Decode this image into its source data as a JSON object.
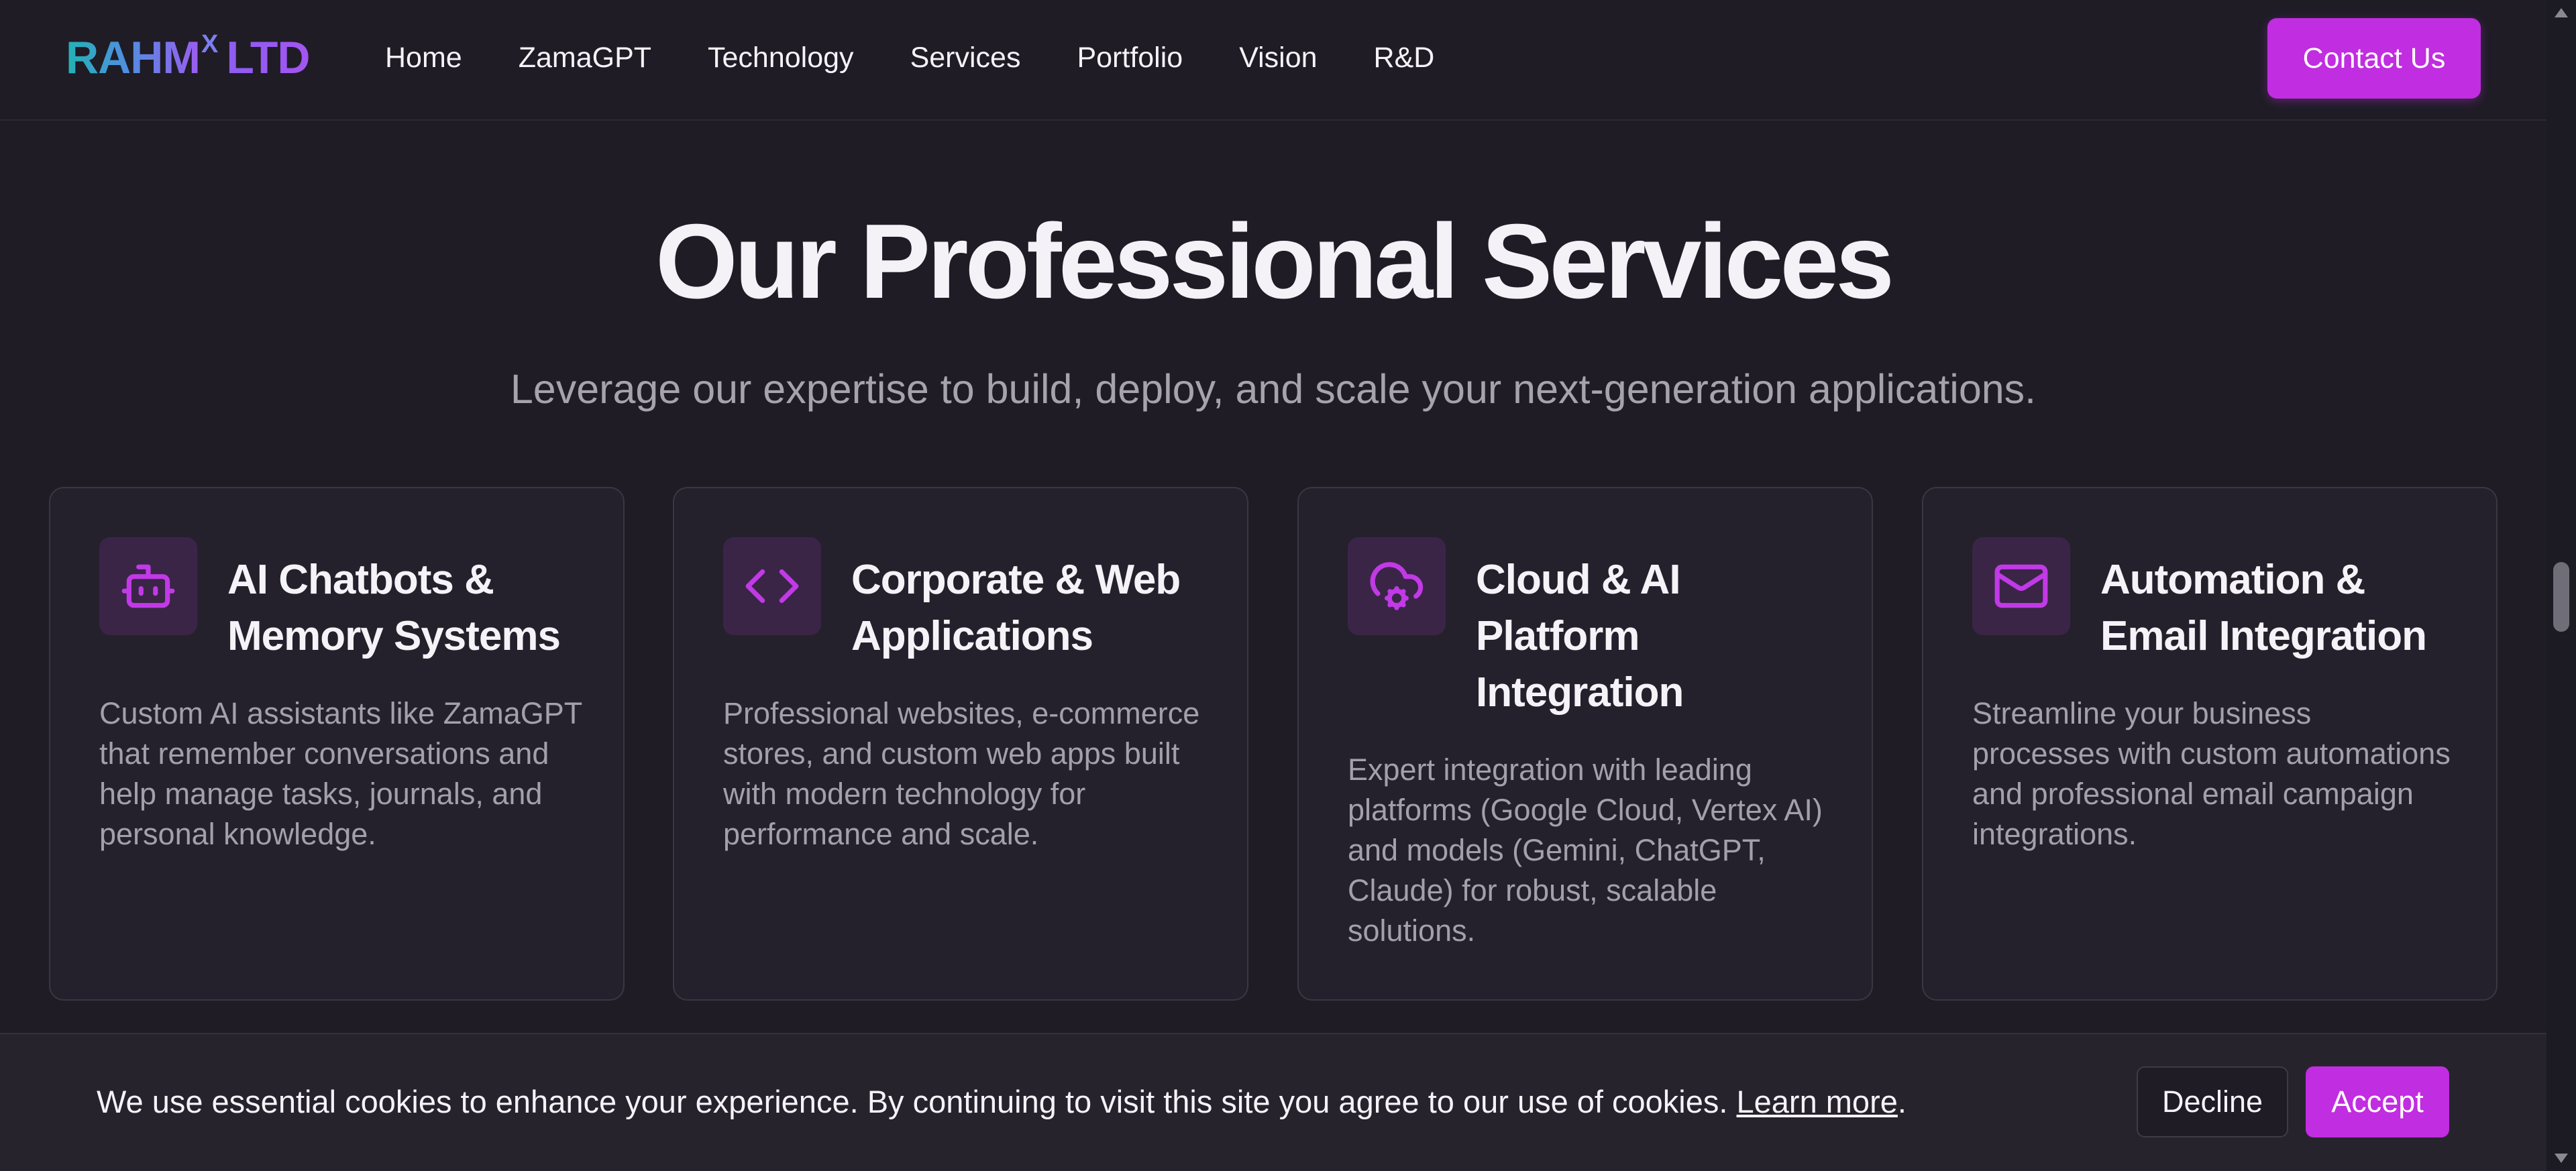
{
  "brand": {
    "name": "RAHM",
    "superscript": "X",
    "suffix": "LTD"
  },
  "nav": {
    "items": [
      {
        "label": "Home"
      },
      {
        "label": "ZamaGPT"
      },
      {
        "label": "Technology"
      },
      {
        "label": "Services"
      },
      {
        "label": "Portfolio"
      },
      {
        "label": "Vision"
      },
      {
        "label": "R&D"
      }
    ],
    "cta_label": "Contact Us"
  },
  "section": {
    "title": "Our Professional Services",
    "subtitle": "Leverage our expertise to build, deploy, and scale your next-generation applications."
  },
  "cards": [
    {
      "icon": "robot-icon",
      "title": "AI Chatbots & Memory Systems",
      "description": "Custom AI assistants like ZamaGPT that remember conversations and help manage tasks, journals, and personal knowledge."
    },
    {
      "icon": "code-icon",
      "title": "Corporate & Web Applications",
      "description": "Professional websites, e-commerce stores, and custom web apps built with modern technology for performance and scale."
    },
    {
      "icon": "cloud-cog-icon",
      "title": "Cloud & AI Platform Integration",
      "description": "Expert integration with leading platforms (Google Cloud, Vertex AI) and models (Gemini, ChatGPT, Claude) for robust, scalable solutions."
    },
    {
      "icon": "mail-icon",
      "title": "Automation & Email Integration",
      "description": "Streamline your business processes with custom automations and professional email campaign integrations."
    }
  ],
  "cookie": {
    "text": "We use essential cookies to enhance your experience. By continuing to visit this site you agree to our use of cookies.",
    "link": "Learn more",
    "period": ".",
    "decline": "Decline",
    "accept": "Accept"
  },
  "colors": {
    "background": "#1f1c26",
    "card": "#24212c",
    "accent": "#c12de0",
    "icon": "#c13ae6"
  }
}
